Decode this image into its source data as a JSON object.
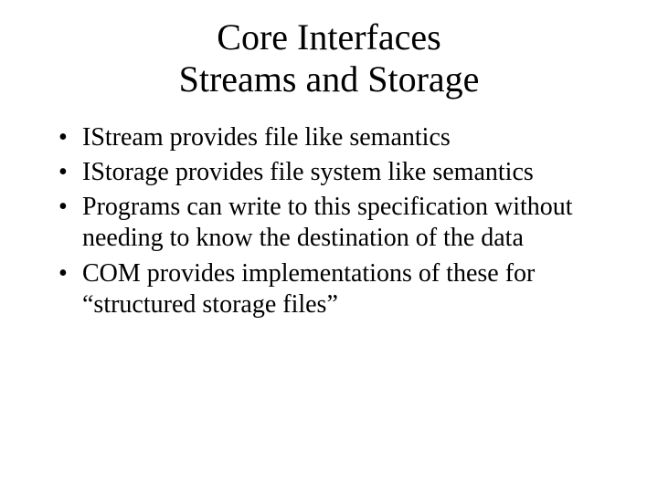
{
  "title": {
    "line1": "Core Interfaces",
    "line2": "Streams and Storage"
  },
  "bullets": [
    "IStream provides file like semantics",
    "IStorage provides file system like semantics",
    "Programs can write to this specification without needing to know the destination of the data",
    "COM provides implementations of these for “structured storage files”"
  ]
}
